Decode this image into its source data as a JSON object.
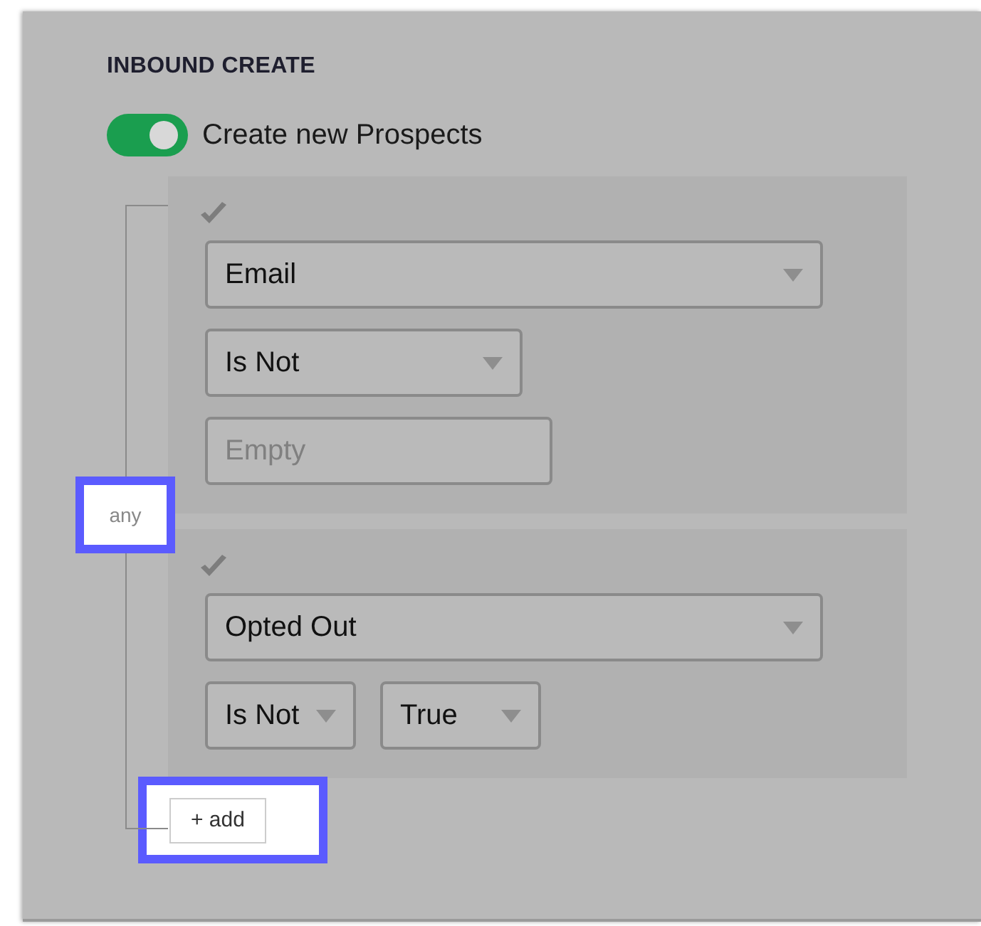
{
  "section_title": "INBOUND CREATE",
  "toggle": {
    "label": "Create new Prospects",
    "on": true
  },
  "match": {
    "label": "any",
    "highlighted": true
  },
  "conditions": [
    {
      "checked": true,
      "rows": [
        [
          {
            "kind": "select",
            "value": "Email"
          }
        ],
        [
          {
            "kind": "select",
            "value": "Is Not"
          }
        ],
        [
          {
            "kind": "input",
            "placeholder": "Empty"
          }
        ]
      ]
    },
    {
      "checked": true,
      "rows": [
        [
          {
            "kind": "select",
            "value": "Opted Out"
          }
        ],
        [
          {
            "kind": "select",
            "value": "Is Not"
          },
          {
            "kind": "select",
            "value": "True"
          }
        ]
      ]
    }
  ],
  "add_button": {
    "label": "+ add",
    "highlighted": true
  }
}
